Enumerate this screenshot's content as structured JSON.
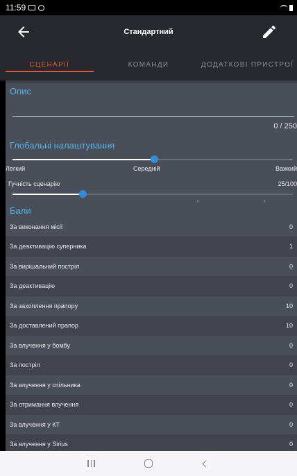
{
  "status_bar": {
    "time": "11:59"
  },
  "app_bar": {
    "title": "Стандартний"
  },
  "tabs": [
    {
      "label": "СЦЕНАРІЇ",
      "active": true
    },
    {
      "label": "КОМАНДИ",
      "active": false
    },
    {
      "label": "ДОДАТКОВІ ПРИСТРОЇ",
      "active": false
    }
  ],
  "description": {
    "title": "Опис",
    "value": "",
    "counter": "0 / 250"
  },
  "global_settings": {
    "title": "Глобальні налаштування",
    "difficulty": {
      "labels": [
        "Легкий",
        "Середній",
        "Важкий"
      ],
      "selected": "Середній"
    },
    "volume": {
      "label": "Гучність сценарію",
      "value": "25/100",
      "level": 0.25
    }
  },
  "points": {
    "title": "Бали",
    "rows": [
      {
        "label": "За виконання місії",
        "value": "0"
      },
      {
        "label": "За деактивацію суперника",
        "value": "1"
      },
      {
        "label": "За вирішальний постріл",
        "value": "0"
      },
      {
        "label": "За деактивацію",
        "value": "0"
      },
      {
        "label": "За захоплення прапору",
        "value": "10"
      },
      {
        "label": "За доставлений прапор",
        "value": "10"
      },
      {
        "label": "За влучення у бомбу",
        "value": "0"
      },
      {
        "label": "За постріл",
        "value": "0"
      },
      {
        "label": "За влучення у спільника",
        "value": "0"
      },
      {
        "label": "За отримання влучення",
        "value": "0"
      },
      {
        "label": "За влучення у КТ",
        "value": "0"
      },
      {
        "label": "За влучення у Sirius",
        "value": "0"
      }
    ]
  },
  "colors": {
    "accent_tab": "#e8533a",
    "accent_section": "#4fb3e8",
    "slider_thumb": "#2f8ddc",
    "background": "#4a4e58",
    "appbar": "#27292e"
  }
}
